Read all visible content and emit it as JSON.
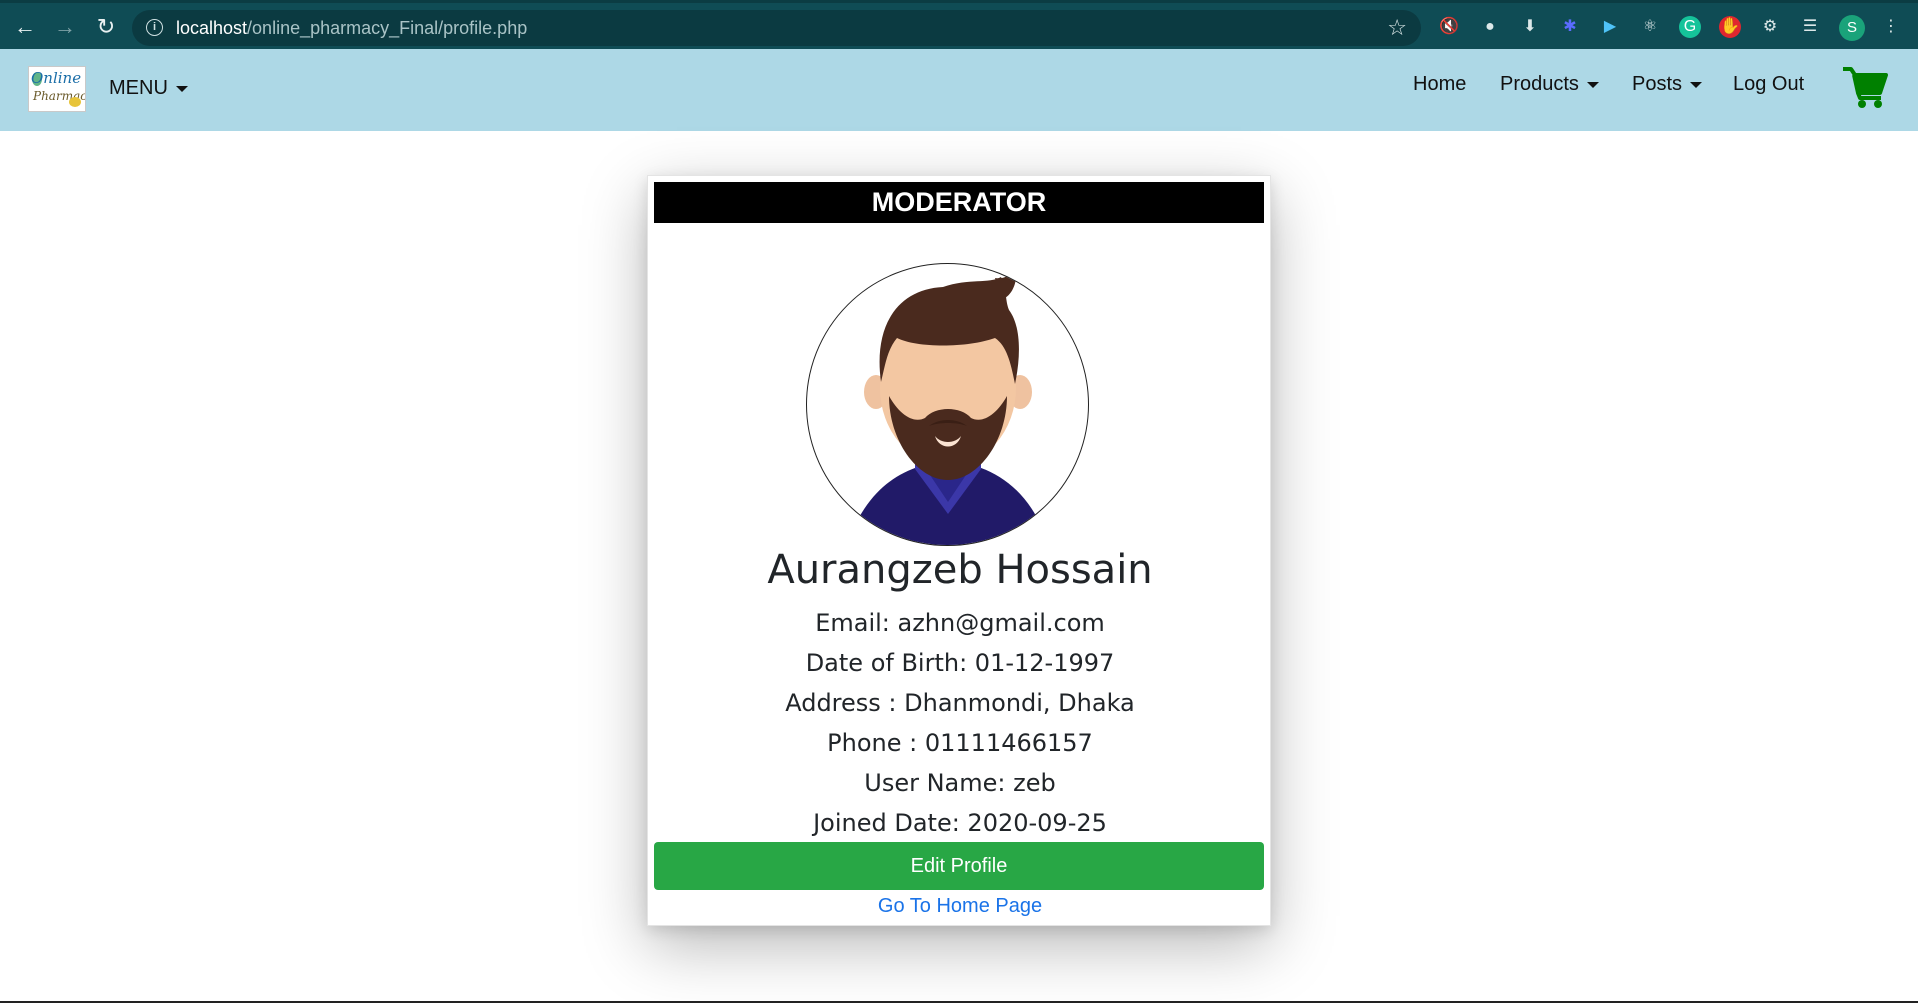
{
  "browser": {
    "url_host": "localhost",
    "url_path": "/online_pharmacy_Final/profile.php",
    "profile_initial": "S"
  },
  "navbar": {
    "menu_label": "MENU",
    "links": {
      "home": "Home",
      "products": "Products",
      "posts": "Posts",
      "logout": "Log Out"
    },
    "cart_color": "#008000"
  },
  "profile": {
    "role": "MODERATOR",
    "name": "Aurangzeb Hossain",
    "email": "Email: azhn@gmail.com",
    "dob": "Date of Birth: 01-12-1997",
    "address": "Address : Dhanmondi, Dhaka",
    "phone": "Phone : 01111466157",
    "username": "User Name: zeb",
    "joined": "Joined Date: 2020-09-25",
    "edit_label": "Edit Profile",
    "home_link": "Go To Home Page"
  },
  "colors": {
    "navbar_bg": "#add8e6",
    "edit_button": "#28a745",
    "link": "#1a73e8",
    "browser_chrome": "#0f4c55"
  }
}
